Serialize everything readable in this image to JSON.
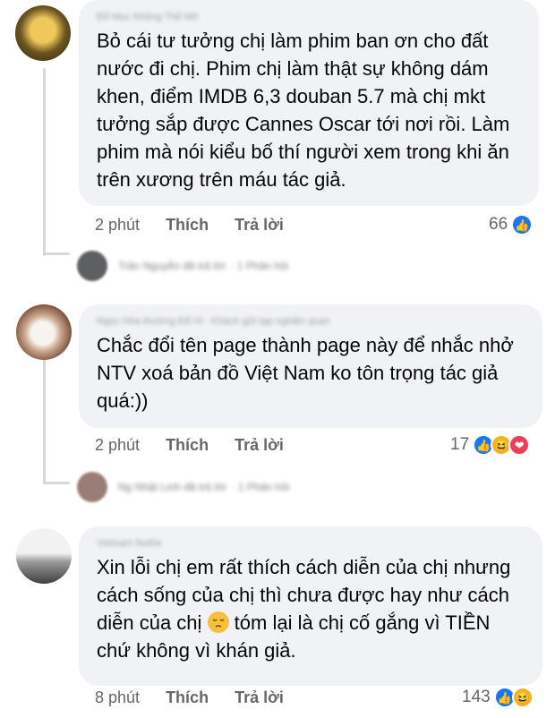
{
  "comments": [
    {
      "author": "Đổ Mục Không Thể Mờ",
      "text": "Bỏ cái tư tưởng chị làm phim ban ơn cho đất nước đi chị. Phim chị làm thật sự không dám khen, điểm IMDB 6,3 douban 5.7 mà chị mkt tưởng sắp được Cannes Oscar tới nơi rồi. Làm phim mà nói kiểu bố thí người xem trong khi ăn trên xương trên máu tác giả.",
      "time": "2 phút",
      "like_label": "Thích",
      "reply_label": "Trả lời",
      "reaction_count": "66",
      "reactions": [
        "like"
      ],
      "reply_preview": {
        "author": "Trần Nguyễn đã trả lời",
        "meta": "· 1 Phản hồi"
      }
    },
    {
      "author": "Ngọc Hòa thường Đổ Hi · Khách gửi tạp nghiện quan",
      "text": "Chắc đổi tên page thành page này để nhắc nhở NTV xoá bản đồ Việt Nam ko tôn trọng tác giả quá:))",
      "time": "2 phút",
      "like_label": "Thích",
      "reply_label": "Trả lời",
      "reaction_count": "17",
      "reactions": [
        "like",
        "haha",
        "love"
      ],
      "reply_preview": {
        "author": "Ng Nhật Linh đã trả lời",
        "meta": "· 1 Phản hồi"
      }
    },
    {
      "author": "Vietnam Nuthe",
      "text_before_emoji": "Xin lỗi chị em rất thích cách diễn của chị nhưng cách sống của chị thì chưa được hay như cách diễn của chị",
      "text_after_emoji": " tóm lại là chị cố gắng vì TIỀN chứ không vì khán giả.",
      "time": "8 phút",
      "like_label": "Thích",
      "reply_label": "Trả lời",
      "reaction_count": "143",
      "reactions": [
        "like",
        "haha"
      ]
    }
  ],
  "colors": {
    "bubble": "#f0f2f5",
    "like": "#1877f2",
    "haha": "#f7b125",
    "love": "#f33e58",
    "meta": "#65676b"
  }
}
